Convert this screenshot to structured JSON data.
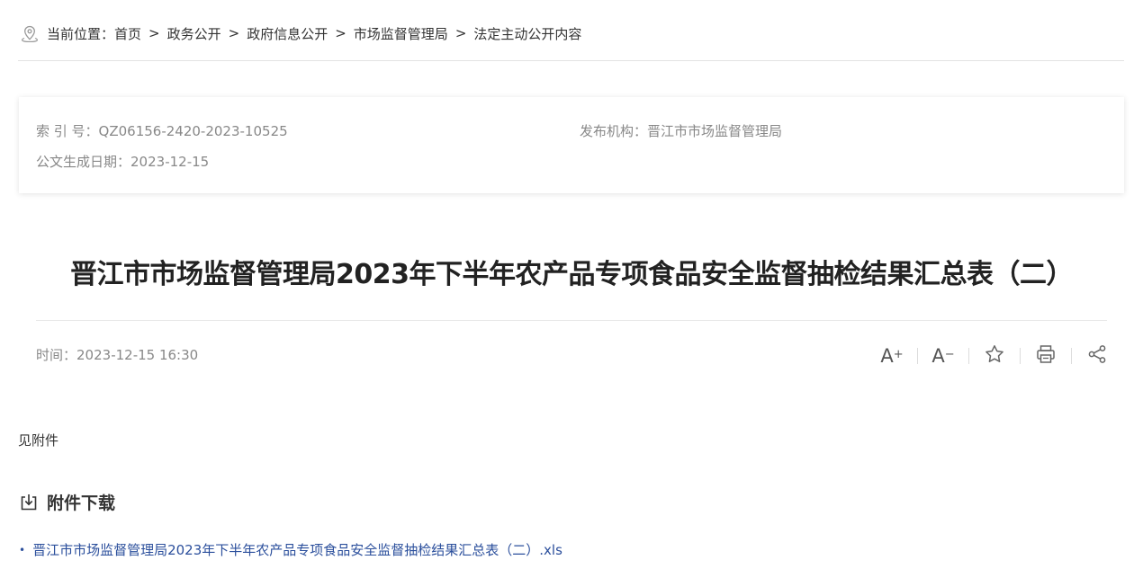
{
  "breadcrumb": {
    "prefix": "当前位置：",
    "items": [
      "首页",
      "政务公开",
      "政府信息公开",
      "市场监督管理局",
      "法定主动公开内容"
    ],
    "separator": ">"
  },
  "meta": {
    "index_label": "索 引 号：",
    "index_value": "QZ06156-2420-2023-10525",
    "org_label": "发布机构：",
    "org_value": "晋江市市场监督管理局",
    "date_label": "公文生成日期：",
    "date_value": "2023-12-15"
  },
  "article": {
    "title": "晋江市市场监督管理局2023年下半年农产品专项食品安全监督抽检结果汇总表（二）",
    "time_label": "时间：",
    "time_value": "2023-12-15 16:30",
    "body": "见附件"
  },
  "tools": {
    "font_increase": "A",
    "font_increase_sign": "+",
    "font_decrease": "A",
    "font_decrease_sign": "−"
  },
  "attachments": {
    "heading": "附件下载",
    "files": [
      {
        "name": "晋江市市场监督管理局2023年下半年农产品专项食品安全监督抽检结果汇总表（二）.xls"
      }
    ]
  },
  "icons": {
    "location": "location-pin-icon",
    "download": "download-icon",
    "favorite": "star-icon",
    "print": "printer-icon",
    "share": "share-icon"
  },
  "colors": {
    "link": "#2b4f9c",
    "meta_text": "#888888",
    "title": "#222222"
  }
}
